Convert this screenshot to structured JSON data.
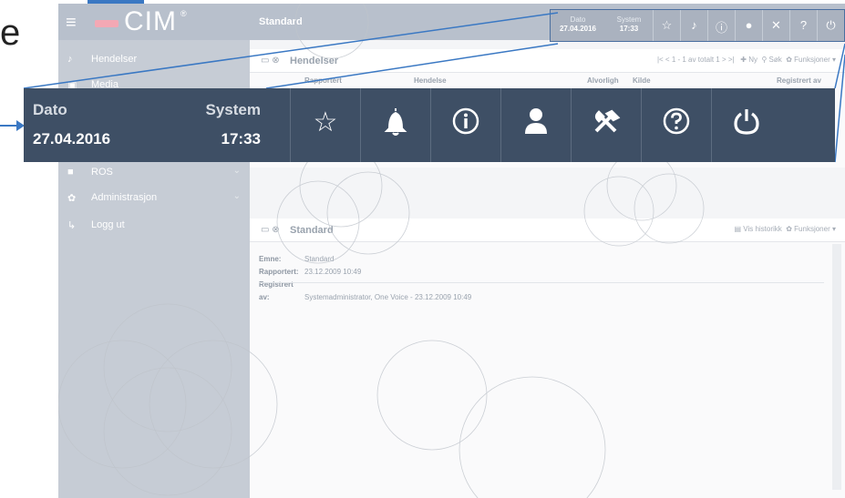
{
  "slide": {
    "letter": "e"
  },
  "app": {
    "logo": "CIM",
    "logo_reg": "®",
    "top_title": "Standard",
    "top": {
      "date_label": "Dato",
      "date_value": "27.04.2016",
      "system_label": "System",
      "system_value": "17:33",
      "icons": [
        "star-icon",
        "bell-icon",
        "info-icon",
        "user-icon",
        "tools-icon",
        "help-icon",
        "power-icon"
      ]
    },
    "sidebar": {
      "items": [
        {
          "icon": "bell-icon",
          "label": "Hendelser"
        },
        {
          "icon": "media-icon",
          "label": "Media"
        },
        {
          "icon": "ros-icon",
          "label": "ROS"
        },
        {
          "icon": "gear-icon",
          "label": "Administrasjon"
        },
        {
          "icon": "logout-icon",
          "label": "Logg ut"
        }
      ]
    },
    "list_panel": {
      "title": "Hendelser",
      "pager": "|<  <  1 - 1 av totalt 1  >  >|",
      "new_label": "Ny",
      "search_label": "Søk",
      "functions_label": "Funksjoner",
      "columns": [
        "Rapportert",
        "Hendelse",
        "Alvorligh",
        "Kilde",
        "Registrert av"
      ]
    },
    "detail_panel": {
      "title": "Standard",
      "history_label": "Vis historikk",
      "functions_label": "Funksjoner",
      "fields": [
        {
          "key": "Emne:",
          "value": "Standard"
        },
        {
          "key": "Rapportert:",
          "value": "23.12.2009 10:49"
        },
        {
          "key": "Registrert av:",
          "value": "Systemadministrator, One Voice - 23.12.2009 10:49"
        }
      ]
    }
  },
  "zoom": {
    "date_label": "Dato",
    "date_value": "27.04.2016",
    "system_label": "System",
    "system_value": "17:33",
    "icons": [
      "star-icon",
      "bell-icon",
      "info-icon",
      "user-icon",
      "tools-icon",
      "help-icon",
      "power-icon"
    ]
  }
}
